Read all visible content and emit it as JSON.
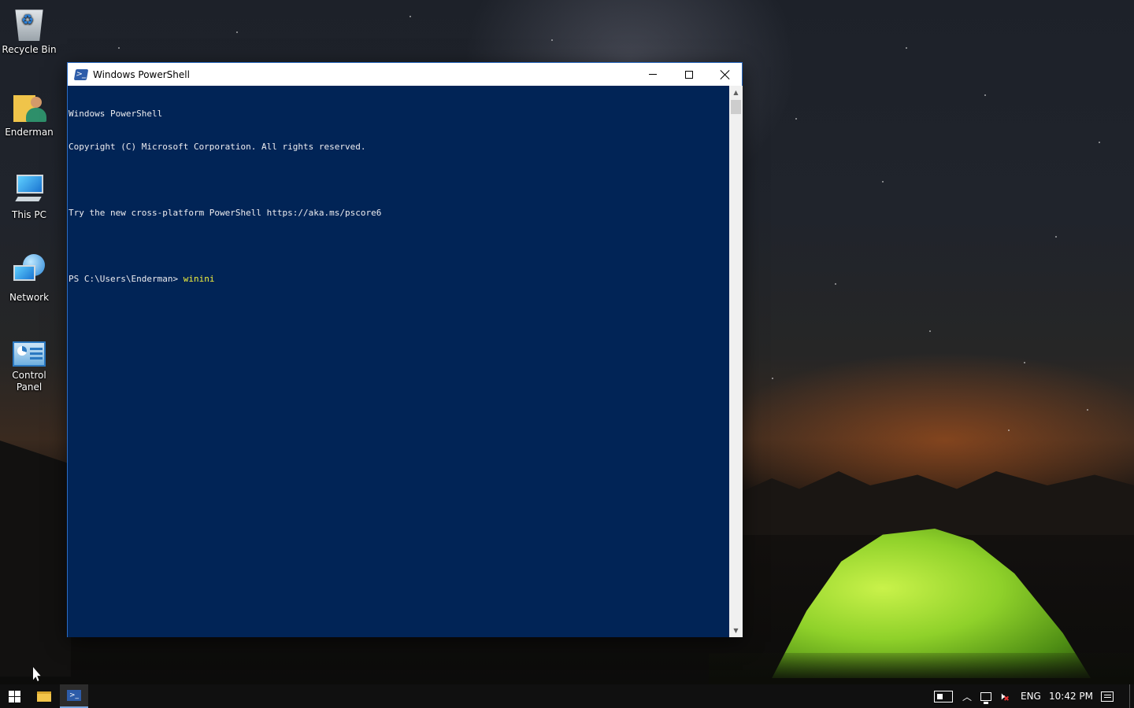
{
  "desktop": {
    "icons": [
      {
        "label": "Recycle Bin",
        "icon": "recycle-bin-icon"
      },
      {
        "label": "Enderman",
        "icon": "user-folder-icon"
      },
      {
        "label": "This PC",
        "icon": "computer-icon"
      },
      {
        "label": "Network",
        "icon": "network-icon"
      },
      {
        "label": "Control Panel",
        "icon": "control-panel-icon"
      }
    ]
  },
  "window": {
    "title": "Windows PowerShell",
    "console": {
      "lines": [
        "Windows PowerShell",
        "Copyright (C) Microsoft Corporation. All rights reserved.",
        "",
        "Try the new cross-platform PowerShell https://aka.ms/pscore6",
        ""
      ],
      "prompt": "PS C:\\Users\\Enderman> ",
      "command": "winini"
    },
    "colors": {
      "console_bg": "#012456",
      "console_fg": "#eeedf0",
      "command_fg": "#f2f23c"
    }
  },
  "taskbar": {
    "tray": {
      "language": "ENG",
      "time": "10:42 PM"
    }
  }
}
